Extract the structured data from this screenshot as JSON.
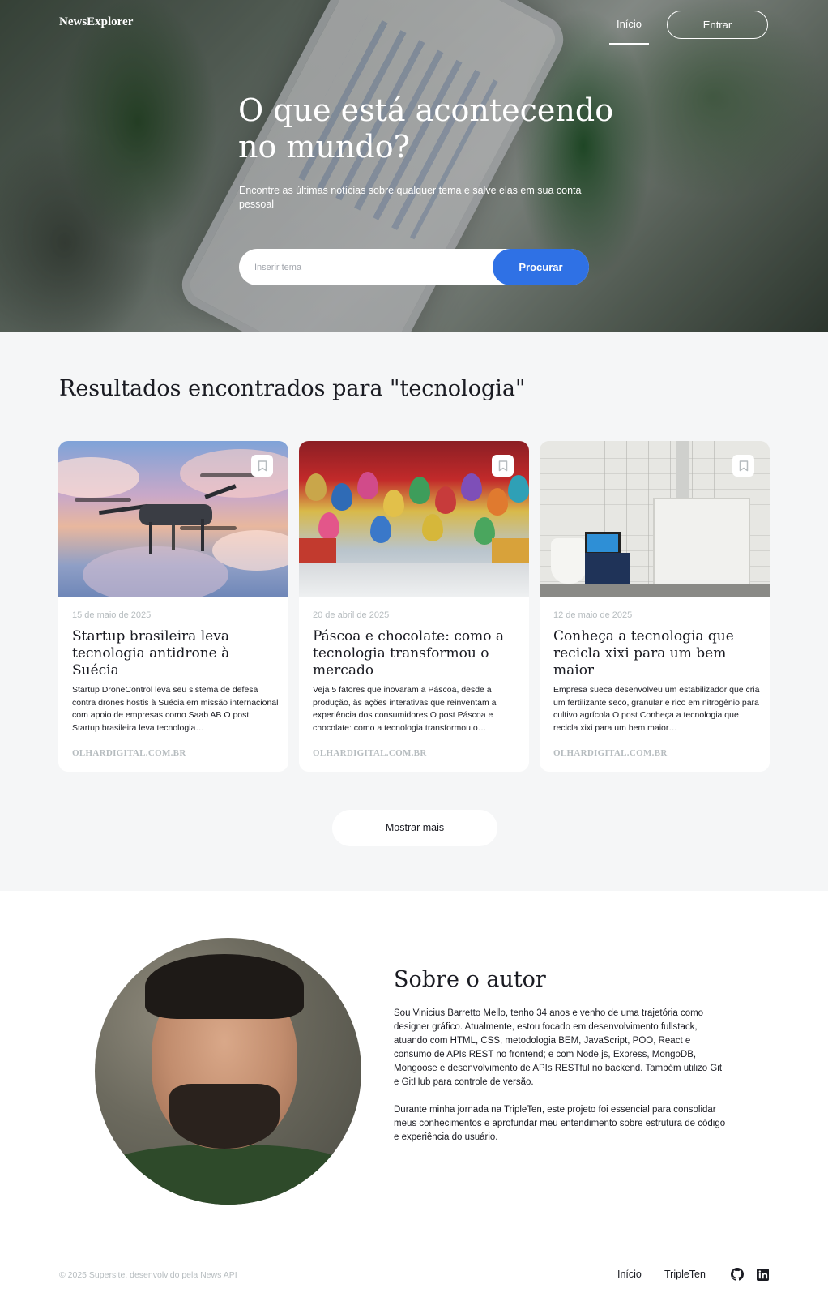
{
  "header": {
    "logo": "NewsExplorer",
    "nav_home": "Início",
    "login_button": "Entrar"
  },
  "hero": {
    "title": "O que está acontecendo no mundo?",
    "subtitle": "Encontre as últimas notícias sobre qualquer tema e salve elas em sua conta pessoal",
    "search_placeholder": "Inserir tema",
    "search_button": "Procurar"
  },
  "results": {
    "title": "Resultados encontrados para \"tecnologia\"",
    "cards": [
      {
        "date": "15 de maio de 2025",
        "title": "Startup brasileira leva tecnologia antidrone à Suécia",
        "text": "Startup DroneControl leva seu sistema de defesa contra drones hostis à Suécia em missão internacional com apoio de empresas como Saab AB O post Startup brasileira leva tecnologia…",
        "source": "OLHARDIGITAL.COM.BR",
        "bookmark_icon": "bookmark-icon"
      },
      {
        "date": "20 de abril de 2025",
        "title": "Páscoa e chocolate: como a tecnologia transformou o mercado",
        "text": "Veja 5 fatores que inovaram a Páscoa, desde a produção, às ações interativas que reinventam a experiência dos consumidores O post Páscoa e chocolate: como a tecnologia transformou o…",
        "source": "OLHARDIGITAL.COM.BR",
        "bookmark_icon": "bookmark-icon"
      },
      {
        "date": "12 de maio de 2025",
        "title": "Conheça a tecnologia que recicla xixi para um bem maior",
        "text": "Empresa sueca desenvolveu um estabilizador que cria um fertilizante seco, granular e rico em nitrogênio para cultivo agrícola O post Conheça a tecnologia que recicla xixi para um bem maior…",
        "source": "OLHARDIGITAL.COM.BR",
        "bookmark_icon": "bookmark-icon"
      }
    ],
    "show_more": "Mostrar mais"
  },
  "about": {
    "title": "Sobre o autor",
    "paragraph1": "Sou Vinicius Barretto Mello, tenho 34 anos e venho de uma trajetória como designer gráfico. Atualmente, estou focado em desenvolvimento fullstack, atuando com HTML, CSS, metodologia BEM, JavaScript, POO, React e consumo de APIs REST no frontend; e com Node.js, Express, MongoDB, Mongoose e desenvolvimento de APIs RESTful no backend. Também utilizo Git e GitHub para controle de versão.",
    "paragraph2": "Durante minha jornada na TripleTen, este projeto foi essencial para consolidar meus conhecimentos e aprofundar meu entendimento sobre estrutura de código e experiência do usuário."
  },
  "footer": {
    "copyright": "© 2025 Supersite, desenvolvido pela News API",
    "link_home": "Início",
    "link_tripleten": "TripleTen",
    "icons": [
      "github-icon",
      "linkedin-icon"
    ]
  },
  "colors": {
    "accent": "#2f71e5",
    "muted": "#b6bcbf",
    "background_section": "#f5f6f7",
    "text": "#1a1b22"
  }
}
